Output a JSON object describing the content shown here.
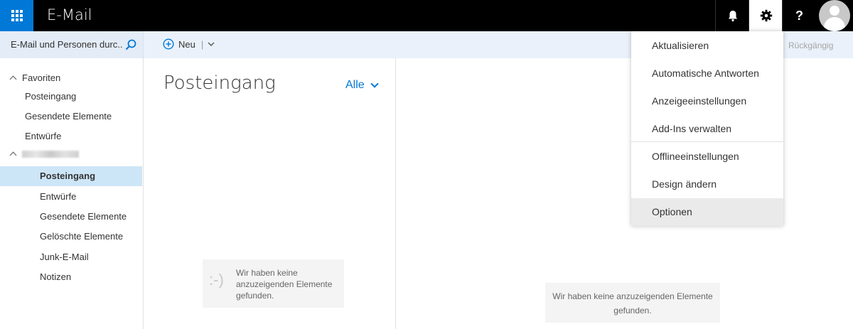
{
  "app": {
    "title": "E-Mail"
  },
  "search": {
    "text": "E-Mail und Personen durc..."
  },
  "toolbar": {
    "new_label": "Neu",
    "new_sep": "|",
    "undo_label": "Rückgängig"
  },
  "nav": {
    "favorites_label": "Favoriten",
    "favorites": [
      "Posteingang",
      "Gesendete Elemente",
      "Entwürfe"
    ],
    "account_items": [
      "Posteingang",
      "Entwürfe",
      "Gesendete Elemente",
      "Gelöschte Elemente",
      "Junk-E-Mail",
      "Notizen"
    ]
  },
  "list": {
    "title": "Posteingang",
    "filter_label": "Alle",
    "empty_face": ":-)",
    "empty_text": "Wir haben keine anzuzeigenden Elemente gefunden."
  },
  "reading": {
    "empty_text": "Wir haben keine anzuzeigenden Elemente gefunden."
  },
  "menu": {
    "items": [
      "Aktualisieren",
      "Automatische Antworten",
      "Anzeigeeinstellungen",
      "Add-Ins verwalten",
      "Offlineeinstellungen",
      "Design ändern",
      "Optionen"
    ]
  },
  "colors": {
    "accent": "#0078d7",
    "topbar": "#000000",
    "selected": "#cde6f7",
    "cmdbar": "#eaf1fa"
  }
}
